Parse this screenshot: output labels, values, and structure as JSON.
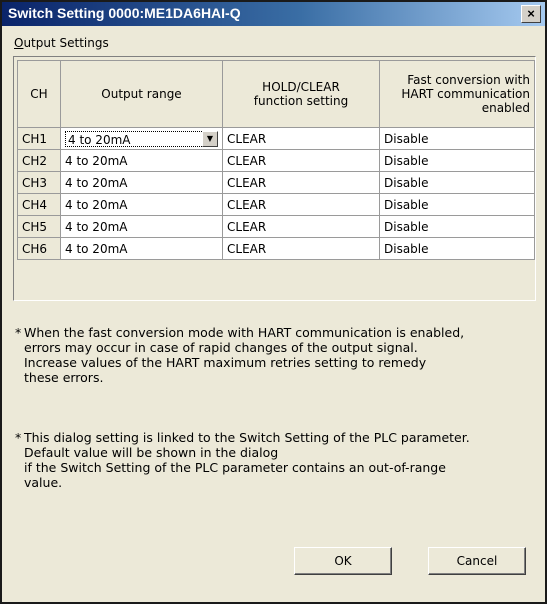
{
  "window": {
    "title": "Switch Setting 0000:ME1DA6HAI-Q",
    "close_glyph": "×"
  },
  "group": {
    "label_prefix": "O",
    "label_rest": "utput Settings"
  },
  "table": {
    "headers": {
      "ch": "CH",
      "range": "Output range",
      "hold_l1": "HOLD/CLEAR",
      "hold_l2": "function setting",
      "fast_l1": "Fast conversion with",
      "fast_l2": "HART communication",
      "fast_l3": "enabled"
    },
    "rows": [
      {
        "ch": "CH1",
        "range": "4 to 20mA",
        "hold": "CLEAR",
        "fast": "Disable"
      },
      {
        "ch": "CH2",
        "range": "4 to 20mA",
        "hold": "CLEAR",
        "fast": "Disable"
      },
      {
        "ch": "CH3",
        "range": "4 to 20mA",
        "hold": "CLEAR",
        "fast": "Disable"
      },
      {
        "ch": "CH4",
        "range": "4 to 20mA",
        "hold": "CLEAR",
        "fast": "Disable"
      },
      {
        "ch": "CH5",
        "range": "4 to 20mA",
        "hold": "CLEAR",
        "fast": "Disable"
      },
      {
        "ch": "CH6",
        "range": "4 to 20mA",
        "hold": "CLEAR",
        "fast": "Disable"
      }
    ]
  },
  "notes": {
    "star": "*",
    "note1": [
      "When the fast conversion mode with HART communication is enabled,",
      "errors may occur in case of rapid changes of the output signal.",
      "Increase values of the HART maximum retries setting to remedy",
      "these errors."
    ],
    "note2": [
      "This dialog setting is linked to the Switch Setting of the PLC parameter.",
      "Default value will be shown in the dialog",
      "if the Switch Setting of the PLC parameter contains an out-of-range",
      "value."
    ]
  },
  "buttons": {
    "ok": "OK",
    "cancel": "Cancel"
  },
  "icons": {
    "dropdown": "chevron-down-icon",
    "close": "close-icon"
  },
  "colors": {
    "title_start": "#0a246a",
    "dialog_bg": "#ece9d8"
  }
}
